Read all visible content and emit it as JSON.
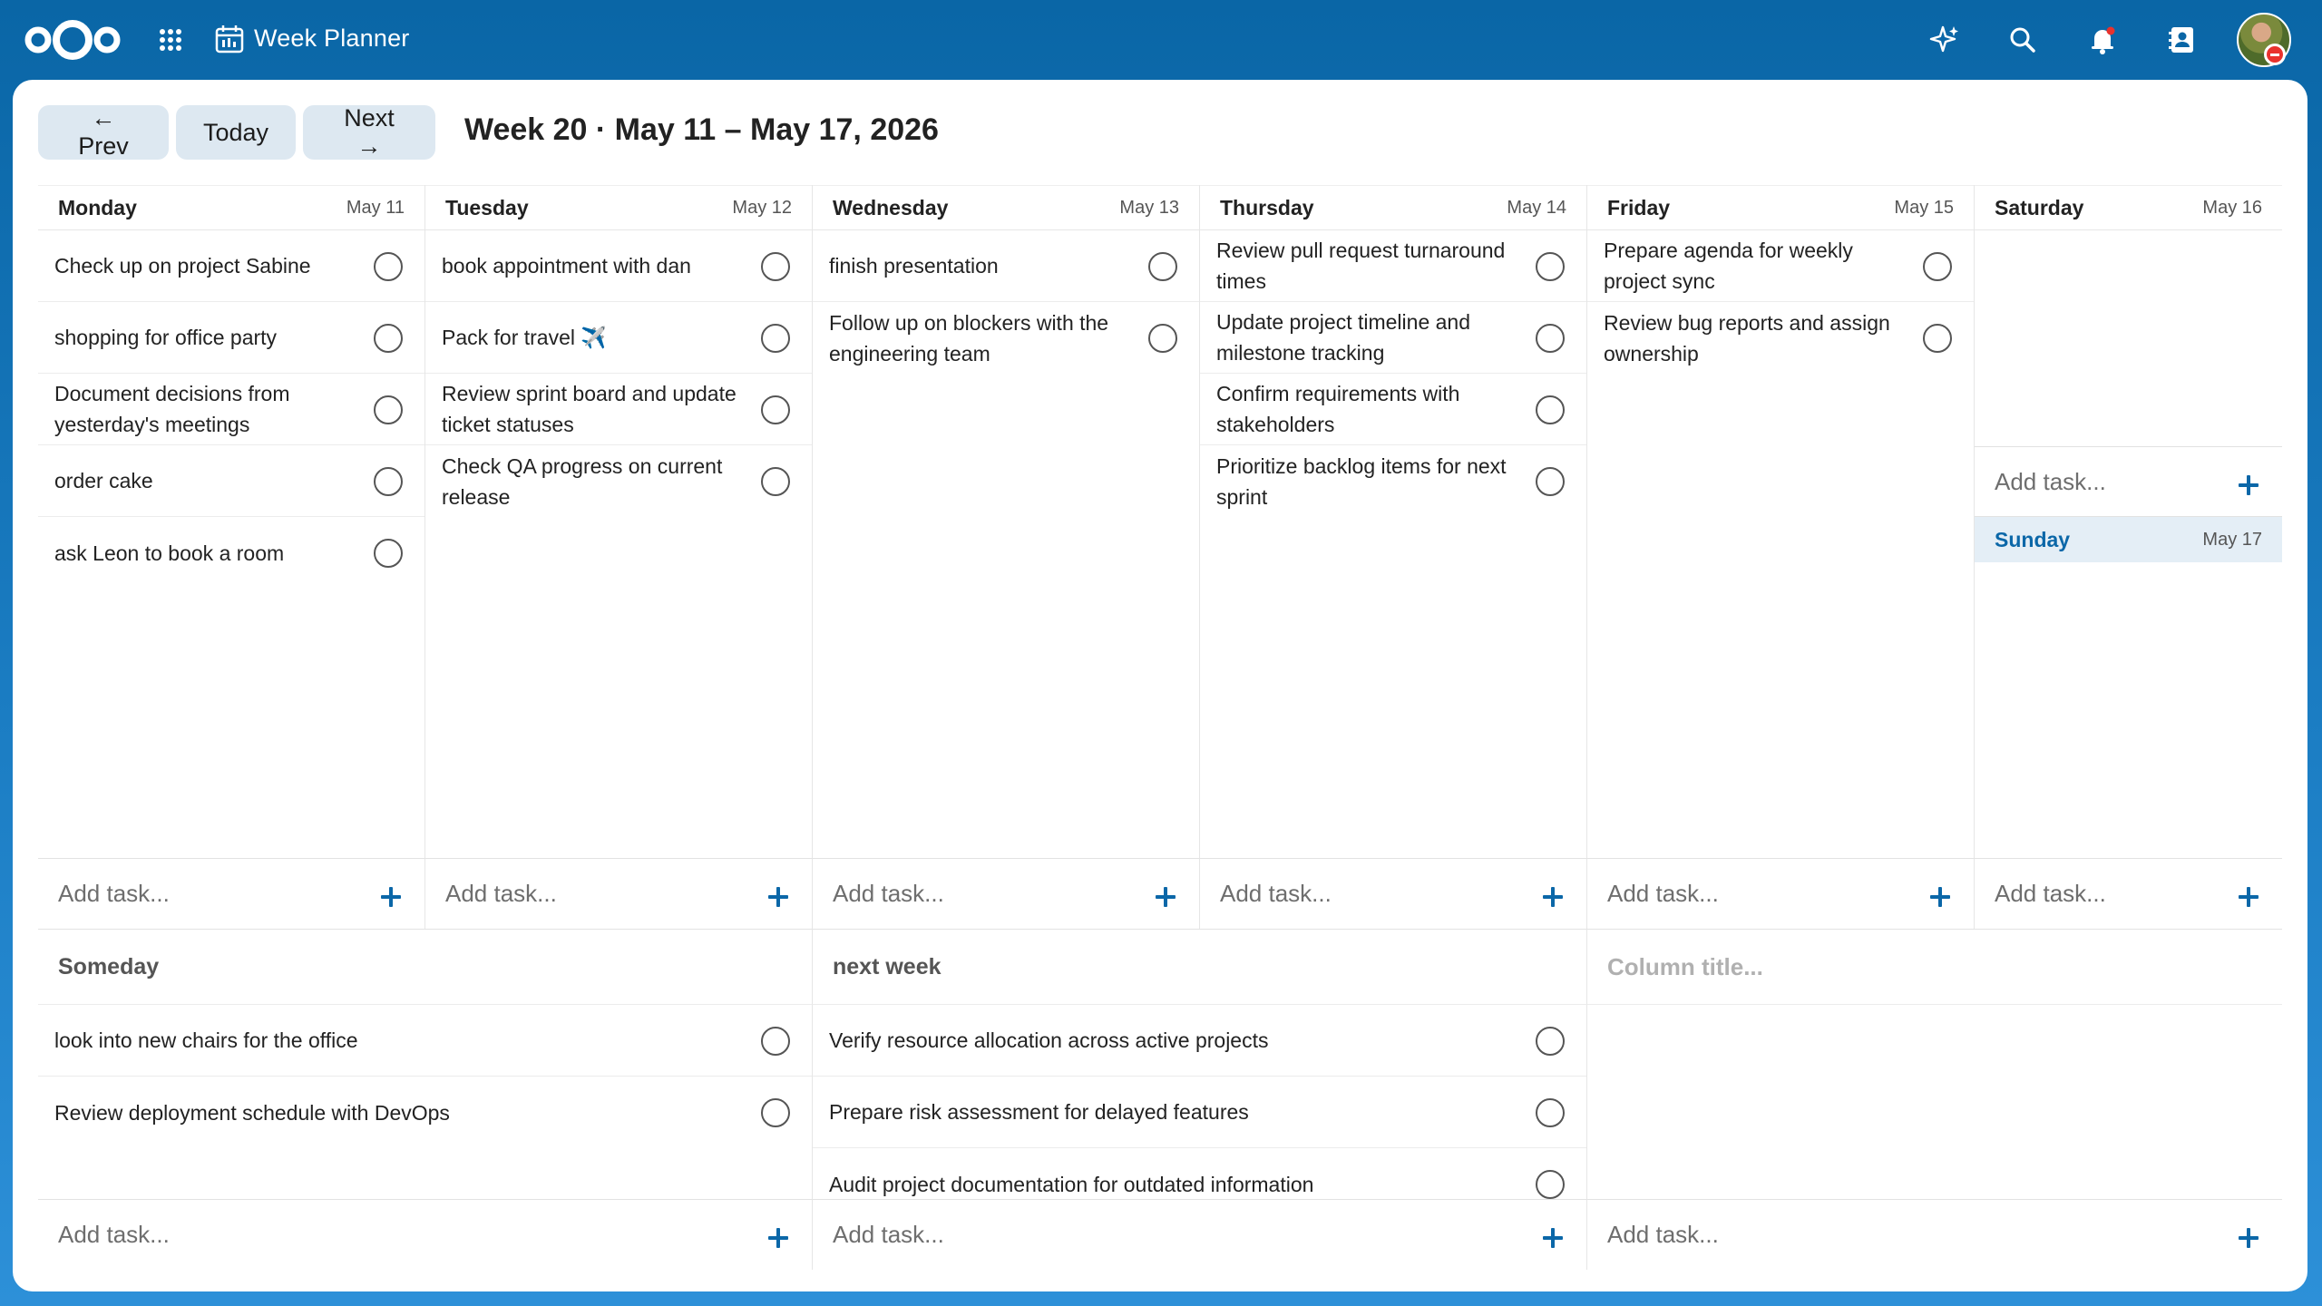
{
  "app": {
    "title": "Week Planner"
  },
  "toolbar": {
    "prev_label": "← Prev",
    "today_label": "Today",
    "next_label": "Next →",
    "week_title": "Week 20 · May 11 – May 17, 2026"
  },
  "add_task_placeholder": "Add task...",
  "days": [
    {
      "name": "Monday",
      "date": "May 11",
      "tasks": [
        "Check up on project Sabine",
        "shopping for office party",
        "Document decisions from yesterday's meetings",
        "order cake",
        "ask Leon to book a room"
      ]
    },
    {
      "name": "Tuesday",
      "date": "May 12",
      "tasks": [
        "book appointment with dan",
        "Pack for travel ✈️",
        "Review sprint board and update ticket statuses",
        "Check QA progress on current release"
      ]
    },
    {
      "name": "Wednesday",
      "date": "May 13",
      "tasks": [
        "finish presentation",
        "Follow up on blockers with the engineering team"
      ]
    },
    {
      "name": "Thursday",
      "date": "May 14",
      "tasks": [
        "Review pull request turnaround times",
        "Update project timeline and milestone tracking",
        "Confirm requirements with stakeholders",
        "Prioritize backlog items for next sprint"
      ]
    },
    {
      "name": "Friday",
      "date": "May 15",
      "tasks": [
        "Prepare agenda for weekly project sync",
        "Review bug reports and assign ownership"
      ]
    },
    {
      "name": "Saturday",
      "date": "May 16",
      "tasks": []
    },
    {
      "name": "Sunday",
      "date": "May 17",
      "tasks": []
    }
  ],
  "sections": [
    {
      "title": "Someday",
      "tasks": [
        "look into new chairs for the office",
        "Review deployment schedule with DevOps"
      ]
    },
    {
      "title": "next week",
      "tasks": [
        "Verify resource allocation across active projects",
        "Prepare risk assessment for delayed features",
        "Audit project documentation for outdated information"
      ]
    },
    {
      "title": "",
      "placeholder": "Column title...",
      "tasks": []
    }
  ],
  "colors": {
    "header_bg": "#0a66a6",
    "accent": "#0b67a8",
    "button_bg": "#dde8f1",
    "today_highlight": "#e4eef6"
  }
}
